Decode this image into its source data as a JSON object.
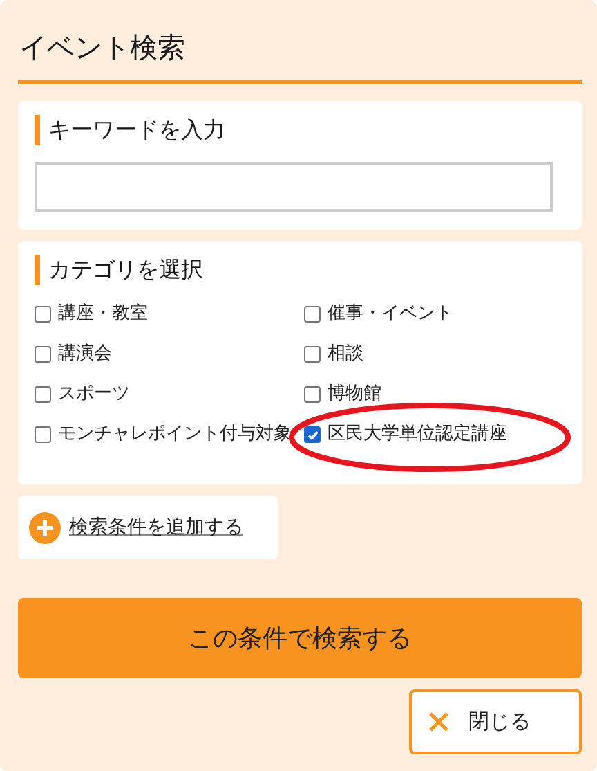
{
  "title": "イベント検索",
  "keyword": {
    "label": "キーワードを入力"
  },
  "category": {
    "label": "カテゴリを選択",
    "items": [
      {
        "label": "講座・教室",
        "checked": false,
        "highlighted": false
      },
      {
        "label": "催事・イベント",
        "checked": false,
        "highlighted": false
      },
      {
        "label": "講演会",
        "checked": false,
        "highlighted": false
      },
      {
        "label": "相談",
        "checked": false,
        "highlighted": false
      },
      {
        "label": "スポーツ",
        "checked": false,
        "highlighted": false
      },
      {
        "label": "博物館",
        "checked": false,
        "highlighted": false
      },
      {
        "label": "モンチャレポイント付与対象",
        "checked": false,
        "highlighted": false
      },
      {
        "label": "区民大学単位認定講座",
        "checked": true,
        "highlighted": true
      }
    ]
  },
  "add_condition": {
    "label": "検索条件を追加する"
  },
  "search_button": {
    "label": "この条件で検索する"
  },
  "close_button": {
    "label": "閉じる"
  }
}
